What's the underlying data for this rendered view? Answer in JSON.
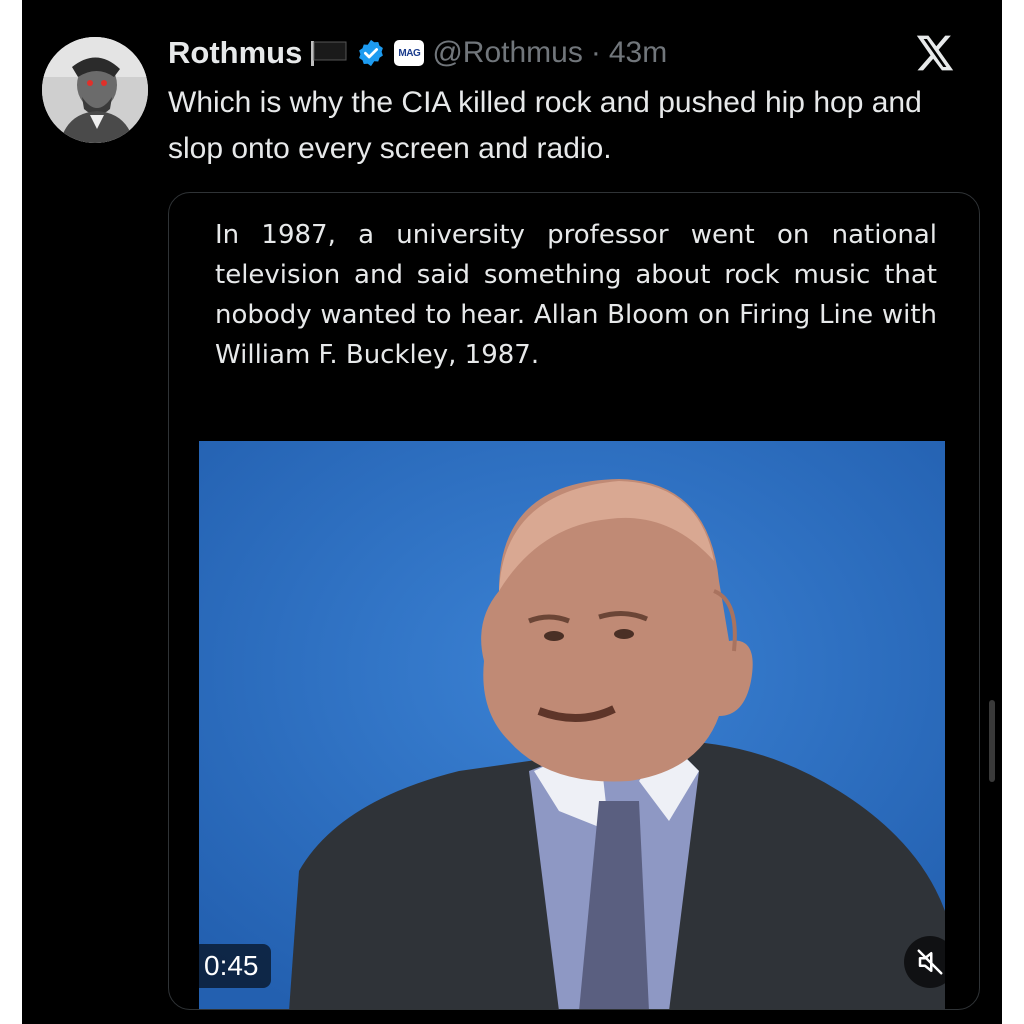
{
  "tweet": {
    "author_name": "Rothmus",
    "handle": "@Rothmus",
    "separator": "·",
    "time_ago": "43m",
    "org_badge_text": "MAG",
    "text": "Which is why the CIA killed rock and pushed hip hop and slop onto every screen and radio."
  },
  "quoted": {
    "text": "In 1987, a university professor went on national television and said something about rock music that nobody wanted to hear. Allan Bloom on Firing Line with William F. Buckley, 1987.",
    "video_timestamp": "0:45"
  },
  "icons": {
    "flag": "black-flag-icon",
    "verified": "verified-badge-icon",
    "close": "x-logo-icon",
    "mute": "muted-speaker-icon"
  },
  "colors": {
    "background": "#000000",
    "text_primary": "#e7e9ea",
    "text_secondary": "#71767b",
    "verified_blue": "#1d9bf0",
    "video_backdrop": "#2d6fc2"
  }
}
